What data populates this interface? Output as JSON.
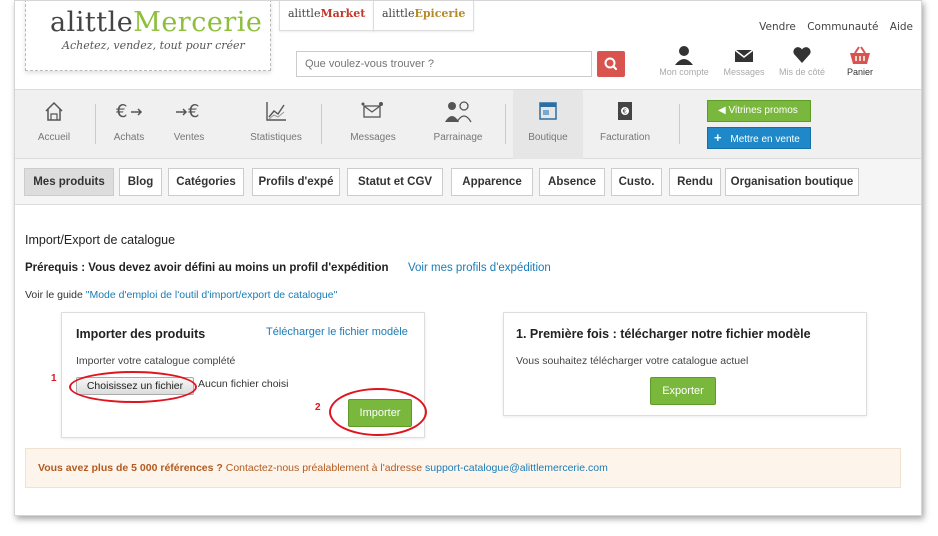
{
  "brand": {
    "logo_pre": "alittle",
    "logo_main": "Mercerie",
    "slogan": "Achetez, vendez, tout pour créer"
  },
  "sites": [
    {
      "pre": "alittle",
      "brand": "Market"
    },
    {
      "pre": "alittle",
      "brand": "Epicerie"
    }
  ],
  "toplinks": [
    "Vendre",
    "Communauté",
    "Aide"
  ],
  "search": {
    "placeholder": "Que voulez-vous trouver ?"
  },
  "header_icons": [
    {
      "label": "Mon compte",
      "icon": "user-icon"
    },
    {
      "label": "Messages",
      "icon": "envelope-icon"
    },
    {
      "label": "Mis de côté",
      "icon": "heart-icon"
    },
    {
      "label": "Panier",
      "icon": "basket-icon"
    }
  ],
  "nav": [
    {
      "label": "Accueil",
      "icon": "home-icon"
    },
    {
      "label": "Achats",
      "icon": "euro-out-icon"
    },
    {
      "label": "Ventes",
      "icon": "euro-in-icon"
    },
    {
      "label": "Statistiques",
      "icon": "chart-icon"
    },
    {
      "label": "Messages",
      "icon": "messages-icon"
    },
    {
      "label": "Parrainage",
      "icon": "referral-icon"
    },
    {
      "label": "Boutique",
      "icon": "shop-icon"
    },
    {
      "label": "Facturation",
      "icon": "invoice-icon"
    }
  ],
  "actions": {
    "vitrines": "Vitrines promos",
    "mettre": "Mettre en vente"
  },
  "subtabs": [
    "Mes produits",
    "Blog",
    "Catégories",
    "Profils d'expé",
    "Statut et CGV",
    "Apparence",
    "Absence",
    "Custo.",
    "Rendu",
    "Organisation boutique"
  ],
  "content": {
    "title": "Import/Export de catalogue",
    "prereq": "Prérequis : Vous devez avoir défini au moins un profil d'expédition",
    "prereq_link": "Voir mes profils d'expédition",
    "guide_pre": "Voir le guide",
    "guide_link": "\"Mode d'emploi de l'outil d'import/export de catalogue\""
  },
  "import_box": {
    "title": "Importer des produits",
    "template_link": "Télécharger le fichier modèle",
    "text": "Importer votre catalogue complété",
    "file_button": "Choisissez un fichier",
    "no_file": "Aucun fichier choisi",
    "import_button": "Importer",
    "anno_1": "1",
    "anno_2": "2"
  },
  "export_box": {
    "title": "1. Première fois : télécharger notre fichier modèle",
    "text": "Vous souhaitez télécharger votre catalogue actuel",
    "export_button": "Exporter"
  },
  "notice": {
    "strong": "Vous avez plus de 5 000 références ?",
    "text": " Contactez-nous préalablement à l'adresse ",
    "email": "support-catalogue@alittlemercerie.com"
  },
  "colors": {
    "green": "#7ab83d",
    "blue_link": "#1b7bb5",
    "blue_button": "#1e88c8",
    "search_red": "#d9534f",
    "annotation_red": "#e0141e"
  }
}
